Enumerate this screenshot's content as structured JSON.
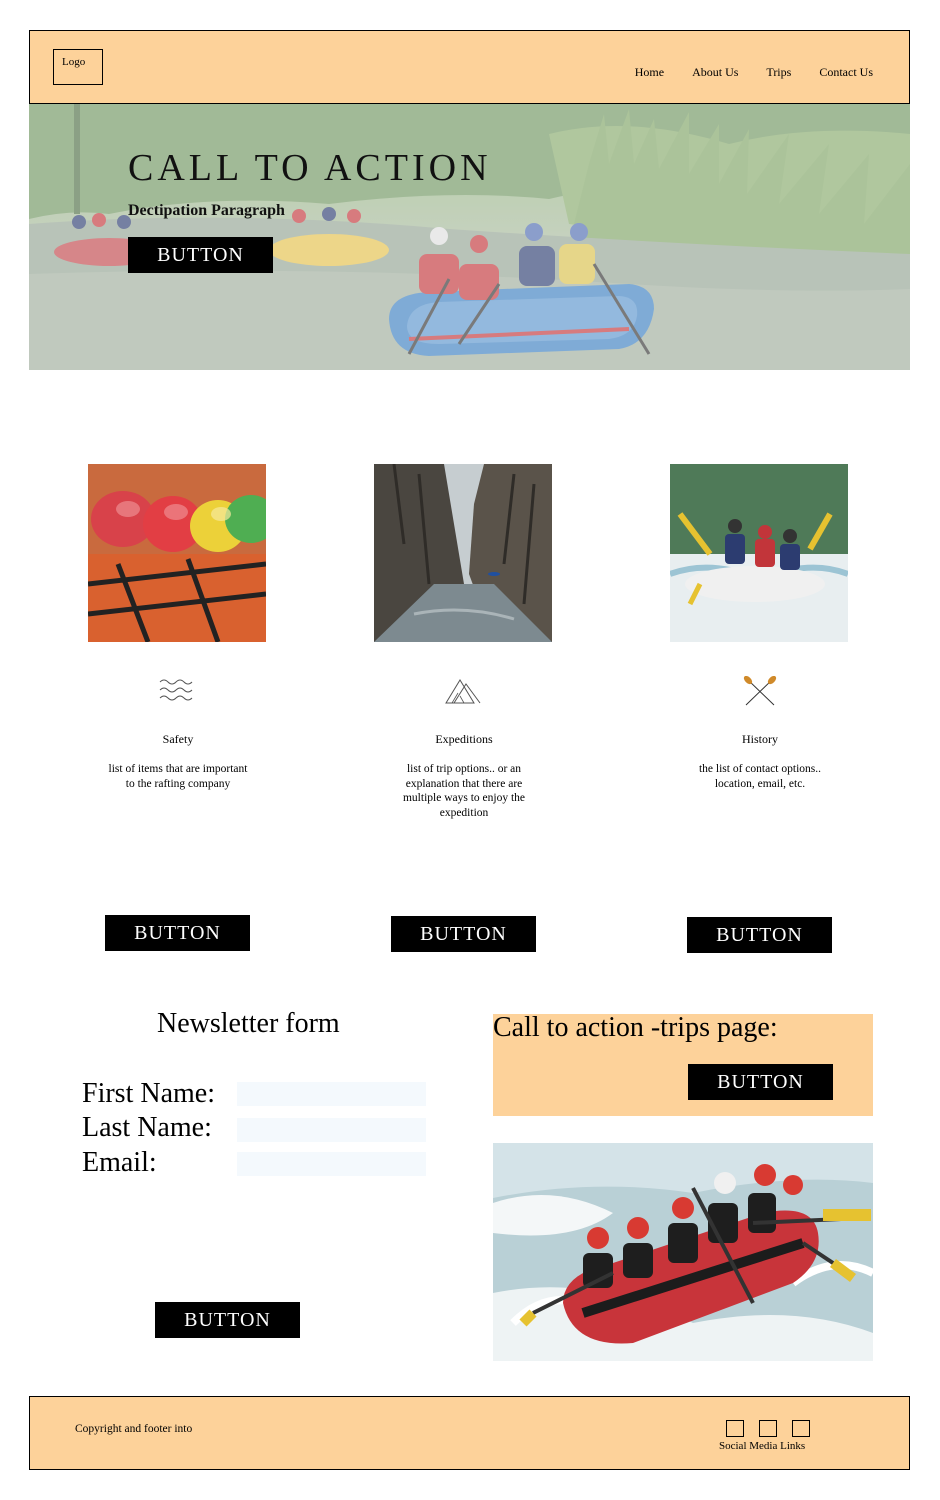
{
  "header": {
    "logo": "Logo",
    "nav": [
      "Home",
      "About Us",
      "Trips",
      "Contact Us"
    ]
  },
  "hero": {
    "title": "CALL TO ACTION",
    "description": "Dectipation Paragraph",
    "button": "BUTTON"
  },
  "features": [
    {
      "title": "Safety",
      "text": "list of items that are important to the rafting company",
      "button": "BUTTON",
      "icon": "waves-icon",
      "image": "helmets-photo"
    },
    {
      "title": "Expeditions",
      "text": "list of trip options.. or an explanation that there are multiple ways to enjoy the expedition",
      "button": "BUTTON",
      "icon": "mountain-icon",
      "image": "canyon-river-photo"
    },
    {
      "title": "History",
      "text": "the list of contact options.. location, email, etc.",
      "button": "BUTTON",
      "icon": "crossed-paddles-icon",
      "image": "rafting-team-photo"
    }
  ],
  "newsletter": {
    "title": "Newsletter form",
    "fields": [
      {
        "label": "First Name:",
        "value": ""
      },
      {
        "label": "Last Name:",
        "value": ""
      },
      {
        "label": "Email:",
        "value": ""
      }
    ],
    "button": "BUTTON"
  },
  "cta_trips": {
    "text": "Call to action -trips page:",
    "button": "BUTTON"
  },
  "footer": {
    "copyright": "Copyright and footer into",
    "social_label": "Social Media Links"
  },
  "colors": {
    "accent": "#fdd29a",
    "button": "#000000",
    "input_bg": "#f4f9fd"
  }
}
